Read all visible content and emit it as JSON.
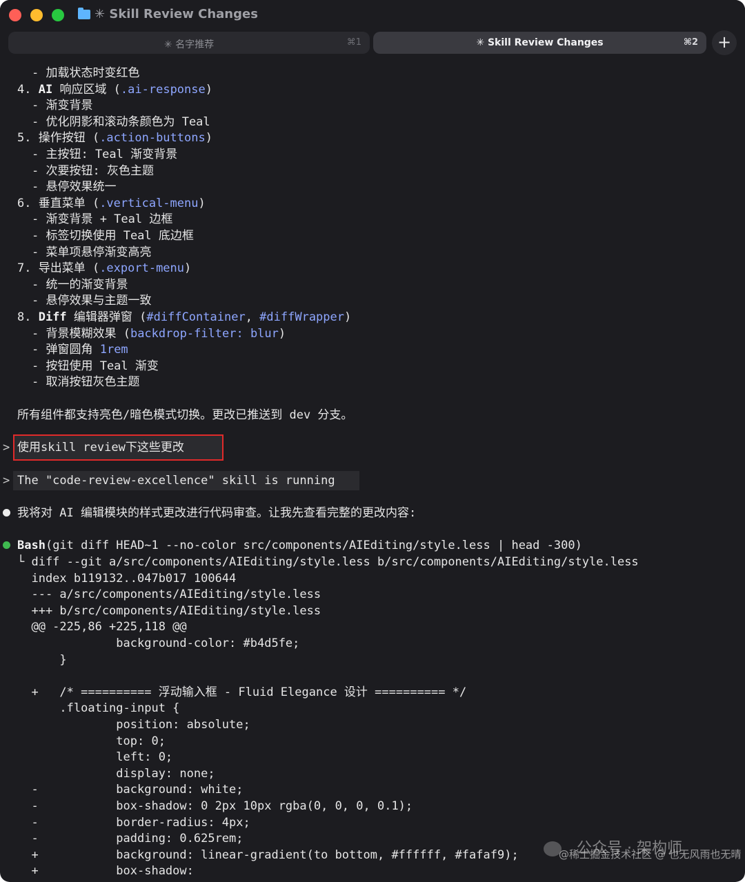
{
  "window": {
    "title": "✳ Skill Review Changes",
    "colors": {
      "background": "#1c1c20",
      "close": "#ff5f57",
      "minimize": "#febc2e",
      "maximize": "#28c840",
      "folder": "#5eb5ff",
      "highlight_border": "#e12a2a",
      "code_accent": "#8ea6ff",
      "status_green": "#3fb950"
    }
  },
  "tabs": [
    {
      "label": "✳ 名字推荐",
      "shortcut": "⌘1",
      "active": false
    },
    {
      "label": "✳ Skill Review Changes",
      "shortcut": "⌘2",
      "active": true
    }
  ],
  "new_tab_label": "+",
  "terminal": {
    "summary_lines": [
      [
        {
          "t": "- 加载状态时变红色",
          "s": "plain"
        }
      ],
      [
        {
          "t": "4. ",
          "s": "plain"
        },
        {
          "t": "AI",
          "s": "bold"
        },
        {
          "t": " 响应区域 (",
          "s": "plain"
        },
        {
          "t": ".ai-response",
          "s": "code"
        },
        {
          "t": ")",
          "s": "plain"
        }
      ],
      [
        {
          "t": "- 渐变背景",
          "s": "plain"
        }
      ],
      [
        {
          "t": "- 优化阴影和滚动条颜色为 Teal",
          "s": "plain"
        }
      ],
      [
        {
          "t": "5. 操作按钮 (",
          "s": "plain"
        },
        {
          "t": ".action-buttons",
          "s": "code"
        },
        {
          "t": ")",
          "s": "plain"
        }
      ],
      [
        {
          "t": "- 主按钮: Teal 渐变背景",
          "s": "plain"
        }
      ],
      [
        {
          "t": "- 次要按钮: 灰色主题",
          "s": "plain"
        }
      ],
      [
        {
          "t": "- 悬停效果统一",
          "s": "plain"
        }
      ],
      [
        {
          "t": "6. 垂直菜单 (",
          "s": "plain"
        },
        {
          "t": ".vertical-menu",
          "s": "code"
        },
        {
          "t": ")",
          "s": "plain"
        }
      ],
      [
        {
          "t": "- 渐变背景 + Teal 边框",
          "s": "plain"
        }
      ],
      [
        {
          "t": "- 标签切换使用 Teal 底边框",
          "s": "plain"
        }
      ],
      [
        {
          "t": "- 菜单项悬停渐变高亮",
          "s": "plain"
        }
      ],
      [
        {
          "t": "7. 导出菜单 (",
          "s": "plain"
        },
        {
          "t": ".export-menu",
          "s": "code"
        },
        {
          "t": ")",
          "s": "plain"
        }
      ],
      [
        {
          "t": "- 统一的渐变背景",
          "s": "plain"
        }
      ],
      [
        {
          "t": "- 悬停效果与主题一致",
          "s": "plain"
        }
      ],
      [
        {
          "t": "8. ",
          "s": "plain"
        },
        {
          "t": "Diff",
          "s": "bold"
        },
        {
          "t": " 编辑器弹窗 (",
          "s": "plain"
        },
        {
          "t": "#diffContainer",
          "s": "code"
        },
        {
          "t": ", ",
          "s": "plain"
        },
        {
          "t": "#diffWrapper",
          "s": "code"
        },
        {
          "t": ")",
          "s": "plain"
        }
      ],
      [
        {
          "t": "- 背景模糊效果 (",
          "s": "plain"
        },
        {
          "t": "backdrop-filter: blur",
          "s": "code"
        },
        {
          "t": ")",
          "s": "plain"
        }
      ],
      [
        {
          "t": "- 弹窗圆角 ",
          "s": "plain"
        },
        {
          "t": "1rem",
          "s": "code"
        }
      ],
      [
        {
          "t": "- 按钮使用 Teal 渐变",
          "s": "plain"
        }
      ],
      [
        {
          "t": "- 取消按钮灰色主题",
          "s": "plain"
        }
      ]
    ],
    "closing_text": "所有组件都支持亮色/暗色模式切换。更改已推送到 dev 分支。",
    "prompt_char": ">",
    "user_message": "使用skill review下这些更改",
    "skill_status": "The \"code-review-excellence\" skill is running",
    "assistant_text": "我将对 AI 编辑模块的样式更改进行代码审查。让我先查看完整的更改内容:",
    "bash_label": "Bash",
    "bash_command": "(git diff HEAD~1 --no-color src/components/AIEditing/style.less | head -300)",
    "diff_lines": [
      "└ diff --git a/src/components/AIEditing/style.less b/src/components/AIEditing/style.less",
      "  index b119132..047b017 100644",
      "  --- a/src/components/AIEditing/style.less",
      "  +++ b/src/components/AIEditing/style.less",
      "  @@ -225,86 +225,118 @@",
      "              background-color: #b4d5fe;",
      "      }",
      "",
      "  +   /* ========== 浮动输入框 - Fluid Elegance 设计 ========== */",
      "      .floating-input {",
      "              position: absolute;",
      "              top: 0;",
      "              left: 0;",
      "              display: none;",
      "  -           background: white;",
      "  -           box-shadow: 0 2px 10px rgba(0, 0, 0, 0.1);",
      "  -           border-radius: 4px;",
      "  -           padding: 0.625rem;",
      "  +           background: linear-gradient(to bottom, #ffffff, #fafaf9);",
      "  +           box-shadow:"
    ]
  },
  "watermark": {
    "main": "公众号 · 架构师",
    "sub": "@稀土掘金技术社区 @ 也无风雨也无晴"
  }
}
